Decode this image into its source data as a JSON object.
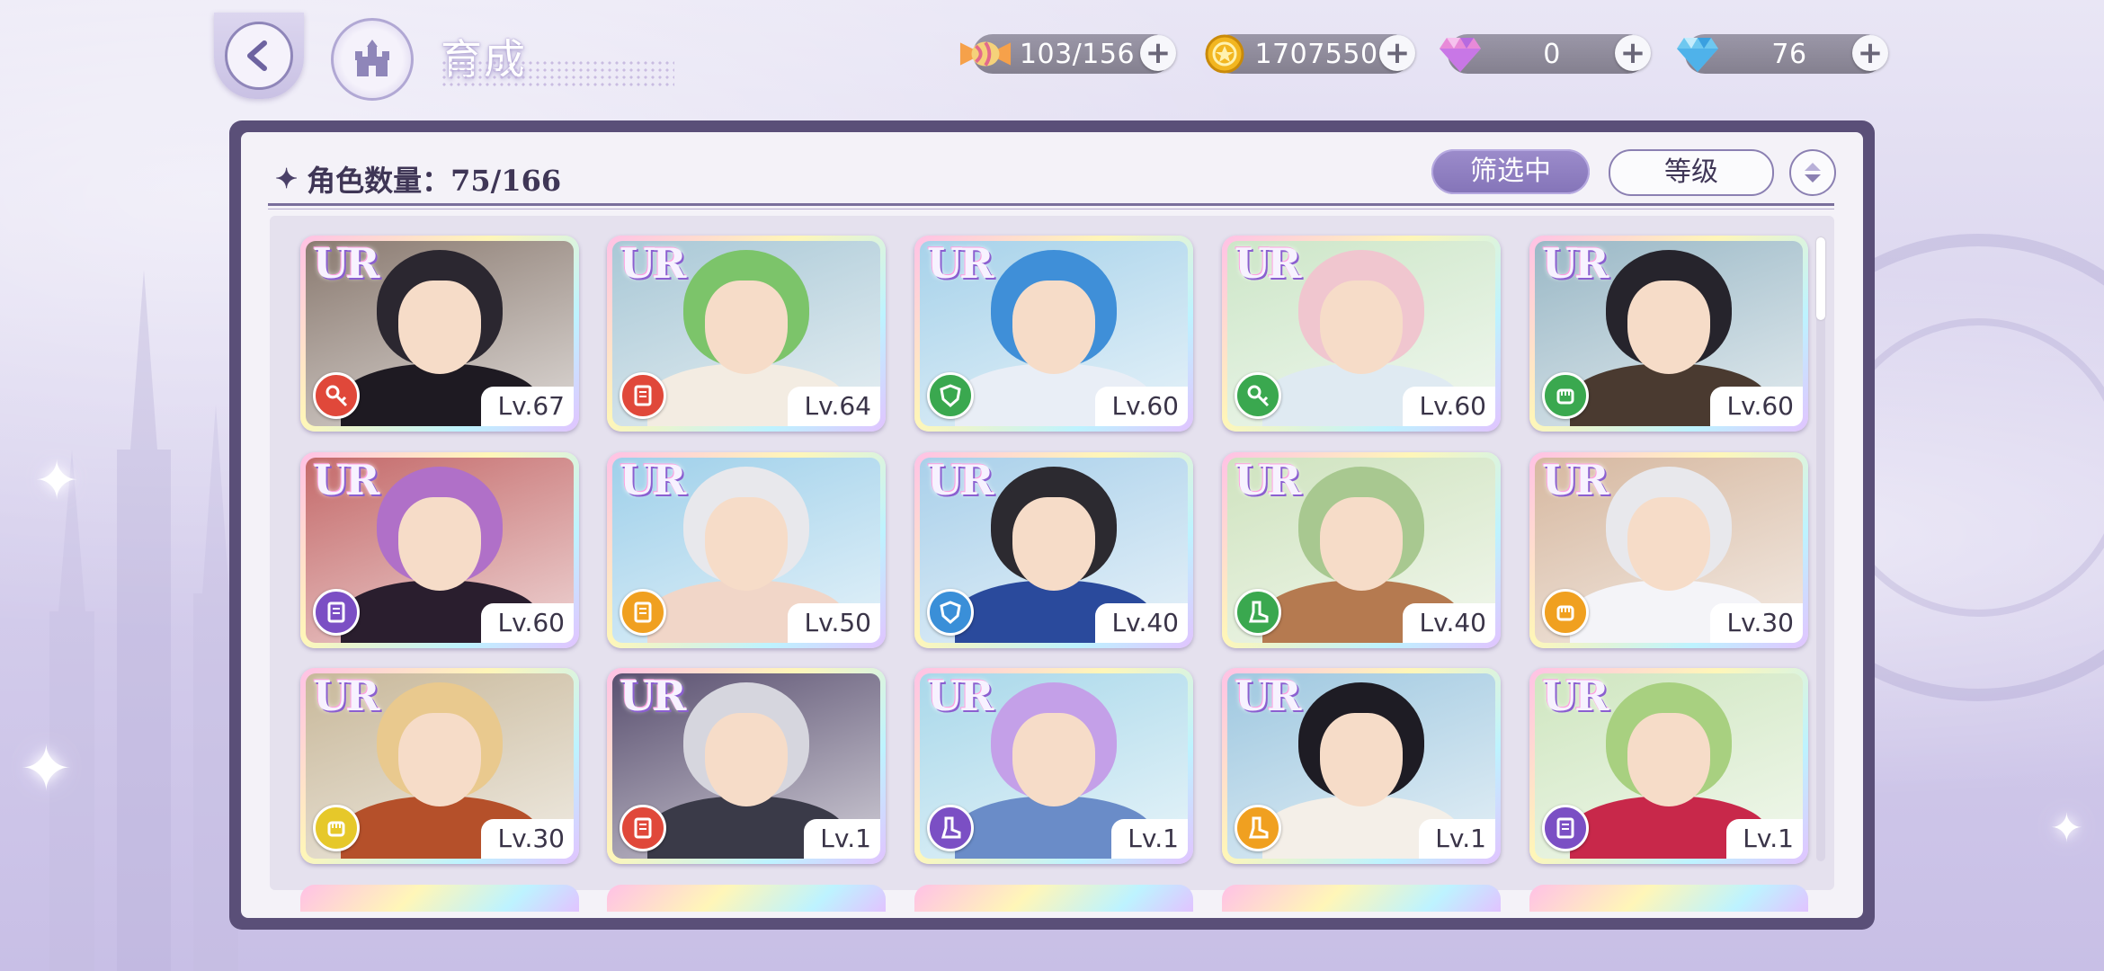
{
  "header": {
    "title": "育成",
    "resources": [
      {
        "id": "stamina",
        "icon": "candy-icon",
        "value": "103/156"
      },
      {
        "id": "gold",
        "icon": "gold-coin-icon",
        "value": "1707550"
      },
      {
        "id": "paid-gem",
        "icon": "pink-diamond-icon",
        "value": "0"
      },
      {
        "id": "free-gem",
        "icon": "blue-diamond-icon",
        "value": "76"
      }
    ]
  },
  "panel": {
    "count_label": "角色数量：75/166",
    "filter_label": "筛选中",
    "sort_label": "等级"
  },
  "colors": {
    "panel_frame": "#5a4f78",
    "filter_button": "#8d7dc0",
    "attr_red": "#e0483a",
    "attr_green": "#3aa84f",
    "attr_purple": "#7b4fc4",
    "attr_orange": "#f0a020",
    "attr_blue": "#3a8fd8",
    "attr_yellow": "#e6c82a"
  },
  "characters": [
    {
      "rarity": "UR",
      "level": "Lv.67",
      "attr": "red",
      "attr_icon": "key-icon",
      "hair": "#2b2730",
      "outfit": "#1e1a22",
      "bg": "#8a7a70"
    },
    {
      "rarity": "UR",
      "level": "Lv.64",
      "attr": "red",
      "attr_icon": "book-icon",
      "hair": "#7cc46a",
      "outfit": "#f3ece2",
      "bg": "#a9c8d6"
    },
    {
      "rarity": "UR",
      "level": "Lv.60",
      "attr": "green",
      "attr_icon": "shield-icon",
      "hair": "#3f8fd8",
      "outfit": "#e9eef6",
      "bg": "#a7d2ea"
    },
    {
      "rarity": "UR",
      "level": "Lv.60",
      "attr": "green",
      "attr_icon": "key-icon",
      "hair": "#f0c6cf",
      "outfit": "#dfeaf2",
      "bg": "#cde6c8"
    },
    {
      "rarity": "UR",
      "level": "Lv.60",
      "attr": "green",
      "attr_icon": "fist-icon",
      "hair": "#26242c",
      "outfit": "#4a3a30",
      "bg": "#9ab8c6"
    },
    {
      "rarity": "UR",
      "level": "Lv.60",
      "attr": "purple",
      "attr_icon": "book-icon",
      "hair": "#b070c8",
      "outfit": "#2a1e2e",
      "bg": "#c46a6a"
    },
    {
      "rarity": "UR",
      "level": "Lv.50",
      "attr": "orange",
      "attr_icon": "book-icon",
      "hair": "#e8e8ec",
      "outfit": "#f1d6c8",
      "bg": "#9fd0ea"
    },
    {
      "rarity": "UR",
      "level": "Lv.40",
      "attr": "blue",
      "attr_icon": "shield-icon",
      "hair": "#2c2a30",
      "outfit": "#2a4a9c",
      "bg": "#a9d0ea"
    },
    {
      "rarity": "UR",
      "level": "Lv.40",
      "attr": "green",
      "attr_icon": "boot-icon",
      "hair": "#a8c890",
      "outfit": "#b57a50",
      "bg": "#cfe3bf"
    },
    {
      "rarity": "UR",
      "level": "Lv.30",
      "attr": "orange",
      "attr_icon": "fist-icon",
      "hair": "#e8e8ec",
      "outfit": "#f4f4f8",
      "bg": "#d6b8a0"
    },
    {
      "rarity": "UR",
      "level": "Lv.30",
      "attr": "yellow",
      "attr_icon": "fist-icon",
      "hair": "#e9c98e",
      "outfit": "#b5502a",
      "bg": "#c8b89a"
    },
    {
      "rarity": "UR",
      "level": "Lv.1",
      "attr": "red",
      "attr_icon": "book-icon",
      "hair": "#d6d6de",
      "outfit": "#3a3a48",
      "bg": "#5a5070"
    },
    {
      "rarity": "UR",
      "level": "Lv.1",
      "attr": "purple",
      "attr_icon": "boot-icon",
      "hair": "#c4a0e8",
      "outfit": "#6a8cc8",
      "bg": "#a9d8ea"
    },
    {
      "rarity": "UR",
      "level": "Lv.1",
      "attr": "orange",
      "attr_icon": "boot-icon",
      "hair": "#1e1c24",
      "outfit": "#f4efe8",
      "bg": "#9fc8e0"
    },
    {
      "rarity": "UR",
      "level": "Lv.1",
      "attr": "purple",
      "attr_icon": "book-icon",
      "hair": "#a8d080",
      "outfit": "#c8284a",
      "bg": "#cfe6c0"
    }
  ]
}
